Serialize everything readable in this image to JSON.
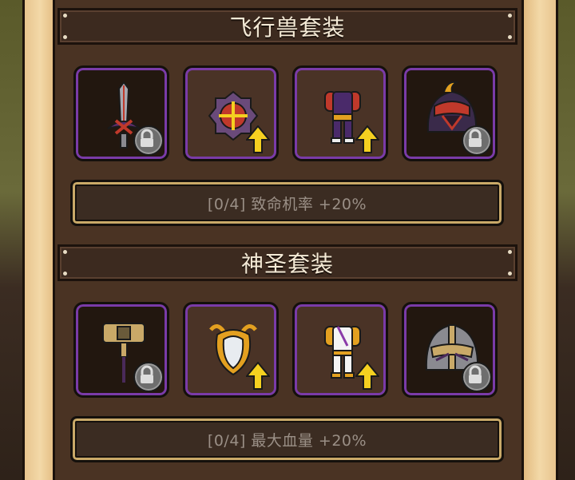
{
  "sets": [
    {
      "title": "飞行兽套装",
      "bonus": "[0/4] 致命机率 +20%",
      "slots": [
        {
          "item": "sword-icon",
          "state": "locked"
        },
        {
          "item": "amulet-icon",
          "state": "upgradable"
        },
        {
          "item": "armor-icon",
          "state": "upgradable"
        },
        {
          "item": "helmet-icon",
          "state": "locked"
        }
      ]
    },
    {
      "title": "神圣套装",
      "bonus": "[0/4] 最大血量 +20%",
      "slots": [
        {
          "item": "hammer-icon",
          "state": "locked"
        },
        {
          "item": "shield-icon",
          "state": "upgradable"
        },
        {
          "item": "robe-icon",
          "state": "upgradable"
        },
        {
          "item": "helmet-icon",
          "state": "locked"
        }
      ]
    }
  ],
  "colors": {
    "slot_border": "#7a3ba8",
    "bonus_border": "#c9a968",
    "upgrade_arrow": "#f5d020",
    "title_text": "#f4ead6"
  }
}
